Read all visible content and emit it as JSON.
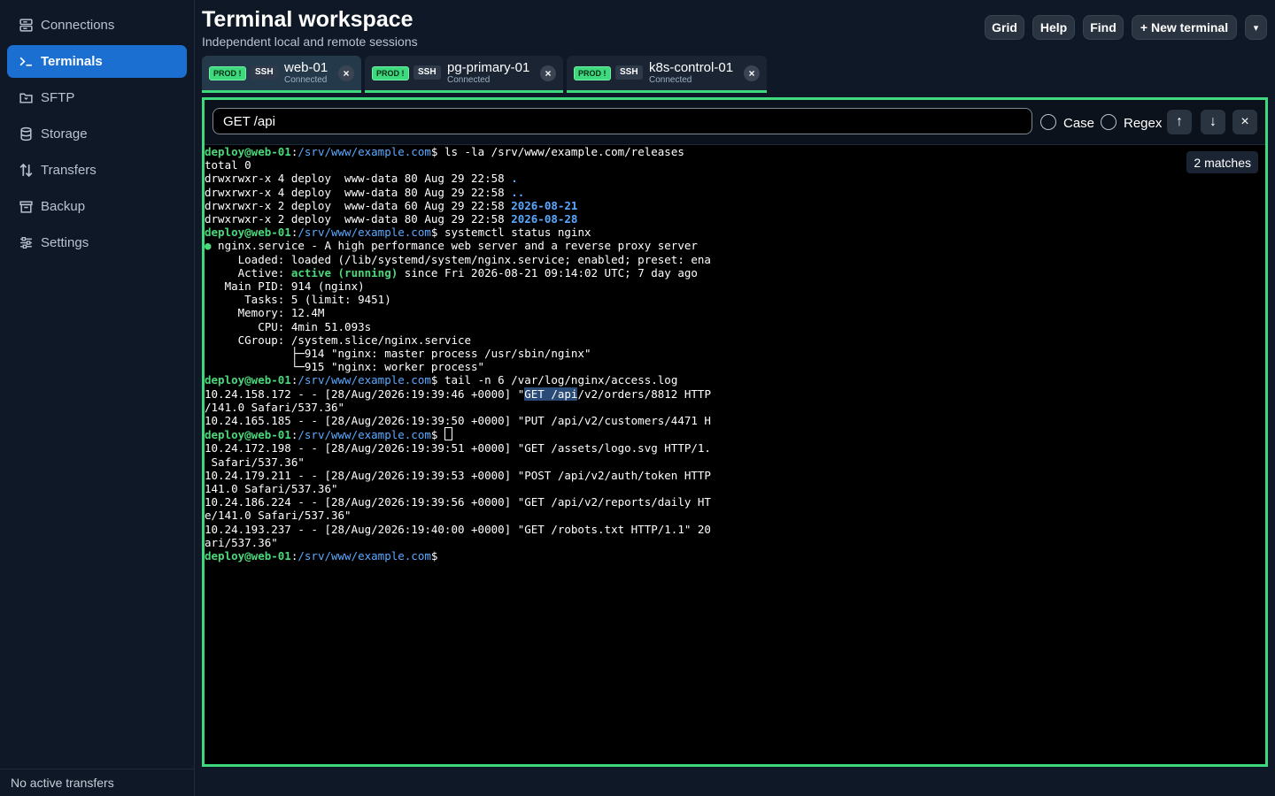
{
  "sidebar": {
    "items": [
      {
        "label": "Connections",
        "icon": "server-icon"
      },
      {
        "label": "Terminals",
        "icon": "terminal-icon"
      },
      {
        "label": "SFTP",
        "icon": "folder-icon"
      },
      {
        "label": "Storage",
        "icon": "database-icon"
      },
      {
        "label": "Transfers",
        "icon": "transfer-icon"
      },
      {
        "label": "Backup",
        "icon": "archive-icon"
      },
      {
        "label": "Settings",
        "icon": "sliders-icon"
      }
    ],
    "footer": "No active transfers"
  },
  "header": {
    "title": "Terminal workspace",
    "subtitle": "Independent local and remote sessions",
    "buttons": {
      "grid": "Grid",
      "help": "Help",
      "find": "Find",
      "new_terminal": "+ New terminal",
      "more": "▾"
    }
  },
  "tabs": [
    {
      "env": "PROD !",
      "proto": "SSH",
      "name": "web-01",
      "status": "Connected",
      "close": "×"
    },
    {
      "env": "PROD !",
      "proto": "SSH",
      "name": "pg-primary-01",
      "status": "Connected",
      "close": "×"
    },
    {
      "env": "PROD !",
      "proto": "SSH",
      "name": "k8s-control-01",
      "status": "Connected",
      "close": "×"
    }
  ],
  "find": {
    "query": "GET /api",
    "case_label": "Case",
    "regex_label": "Regex",
    "prev": "↑",
    "next": "↓",
    "close": "×",
    "matches": "2 matches"
  },
  "terminal": {
    "user": "deploy@web-01",
    "colon": ":",
    "path": "/srv/www/example.com",
    "dollar": "$",
    "cmd1": " ls -la /srv/www/example.com/releases",
    "ls": {
      "total": "total 0",
      "rows": [
        {
          "pre": "drwxrwxr-x 4 deploy  www-data 80 Aug 29 22:58 ",
          "name": "."
        },
        {
          "pre": "drwxrwxr-x 4 deploy  www-data 80 Aug 29 22:58 ",
          "name": ".."
        },
        {
          "pre": "drwxrwxr-x 2 deploy  www-data 60 Aug 29 22:58 ",
          "name": "2026-08-21"
        },
        {
          "pre": "drwxrwxr-x 2 deploy  www-data 80 Aug 29 22:58 ",
          "name": "2026-08-28"
        }
      ]
    },
    "cmd2": " systemctl status nginx",
    "status": {
      "dot": "●",
      "unit": " nginx.service - A high performance web server and a reverse proxy server",
      "loaded": "     Loaded: loaded (/lib/systemd/system/nginx.service; enabled; preset: ena",
      "active_pre": "     Active: ",
      "active_state": "active (running)",
      "active_post": " since Fri 2026-08-21 09:14:02 UTC; 7 day ago",
      "pid": "   Main PID: 914 (nginx)",
      "tasks": "      Tasks: 5 (limit: 9451)",
      "memory": "     Memory: 12.4M",
      "cpu": "        CPU: 4min 51.093s",
      "cgroup": "     CGroup: /system.slice/nginx.service",
      "proc1": "             ├─914 \"nginx: master process /usr/sbin/nginx\"",
      "proc2": "             └─915 \"nginx: worker process\""
    },
    "cmd3": " tail -n 6 /var/log/nginx/access.log",
    "log1_pre": "10.24.158.172 - - [28/Aug/2026:19:39:46 +0000] \"",
    "log1_match": "GET /api",
    "log1_post": "/v2/orders/8812 HTTP",
    "log1_wrap": "/141.0 Safari/537.36\"",
    "log2": "10.24.165.185 - - [28/Aug/2026:19:39:50 +0000] \"PUT /api/v2/customers/4471 H",
    "log3": "10.24.172.198 - - [28/Aug/2026:19:39:51 +0000] \"GET /assets/logo.svg HTTP/1.",
    "log3_wrap": " Safari/537.36\"",
    "log4": "10.24.179.211 - - [28/Aug/2026:19:39:53 +0000] \"POST /api/v2/auth/token HTTP",
    "log4_wrap": "141.0 Safari/537.36\"",
    "log5": "10.24.186.224 - - [28/Aug/2026:19:39:56 +0000] \"GET /api/v2/reports/daily HT",
    "log5_wrap": "e/141.0 Safari/537.36\"",
    "log6": "10.24.193.237 - - [28/Aug/2026:19:40:00 +0000] \"GET /robots.txt HTTP/1.1\" 20",
    "log6_wrap": "ari/537.36\""
  },
  "colors": {
    "accent": "#1b6fd1",
    "success": "#3ed97c",
    "link": "#5aa9ff"
  }
}
